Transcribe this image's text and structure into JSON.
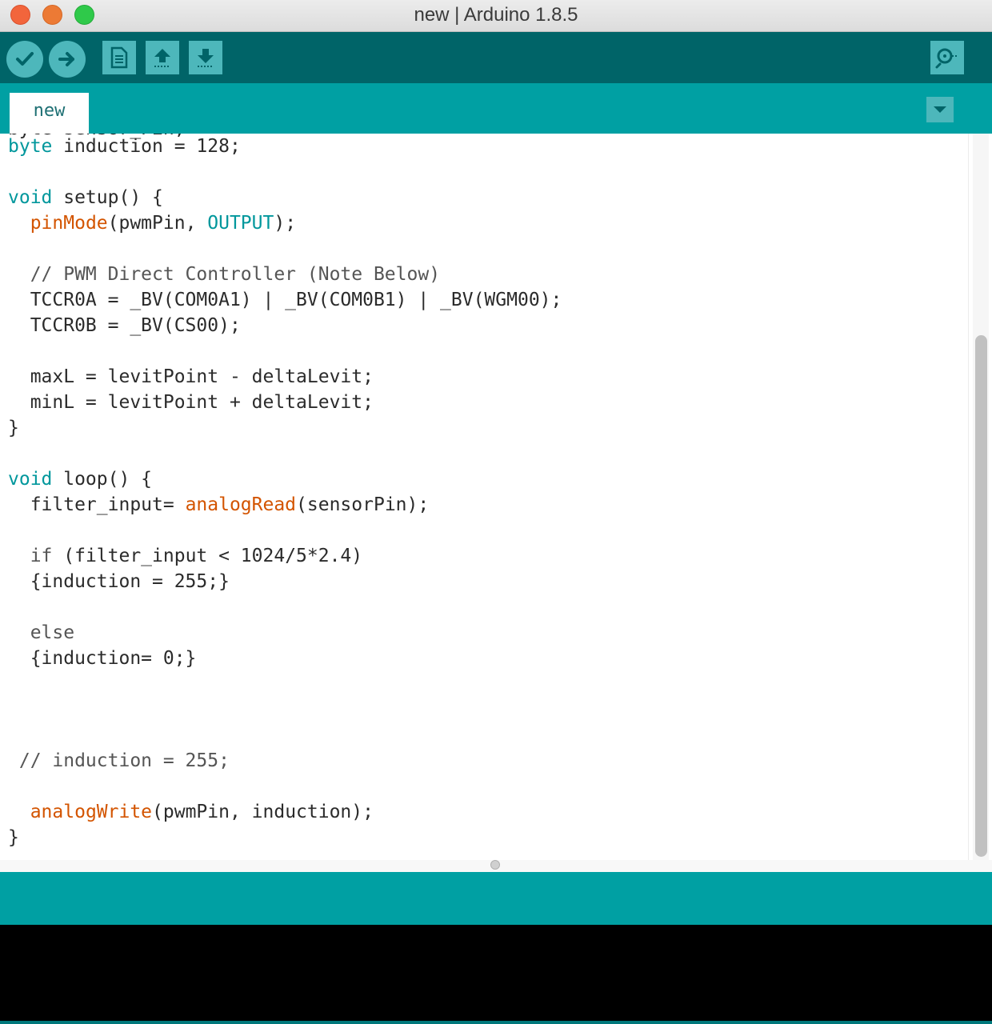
{
  "window": {
    "title": "new | Arduino 1.8.5"
  },
  "toolbar": {
    "buttons": [
      {
        "id": "verify",
        "icon": "check-icon"
      },
      {
        "id": "upload",
        "icon": "arrow-right-icon"
      },
      {
        "id": "new",
        "icon": "document-icon"
      },
      {
        "id": "open",
        "icon": "arrow-up-icon"
      },
      {
        "id": "save",
        "icon": "arrow-down-icon"
      },
      {
        "id": "serial-monitor",
        "icon": "magnifier-icon"
      }
    ]
  },
  "tabs": [
    {
      "label": "new",
      "active": true
    }
  ],
  "editor": {
    "lines": [
      [
        {
          "t": "byte",
          "c": "kw"
        },
        {
          "t": " induction = 128;",
          "c": ""
        }
      ],
      [],
      [
        {
          "t": "void",
          "c": "kw"
        },
        {
          "t": " setup() {",
          "c": ""
        }
      ],
      [
        {
          "t": "  ",
          "c": ""
        },
        {
          "t": "pinMode",
          "c": "fn"
        },
        {
          "t": "(pwmPin, ",
          "c": ""
        },
        {
          "t": "OUTPUT",
          "c": "kw"
        },
        {
          "t": ");",
          "c": ""
        }
      ],
      [],
      [
        {
          "t": "  // PWM Direct Controller (Note Below)",
          "c": "cmt"
        }
      ],
      [
        {
          "t": "  TCCR0A = _BV(COM0A1) | _BV(COM0B1) | _BV(WGM00);",
          "c": ""
        }
      ],
      [
        {
          "t": "  TCCR0B = _BV(CS00);",
          "c": ""
        }
      ],
      [],
      [
        {
          "t": "  maxL = levitPoint - deltaLevit;",
          "c": ""
        }
      ],
      [
        {
          "t": "  minL = levitPoint + deltaLevit;",
          "c": ""
        }
      ],
      [
        {
          "t": "}",
          "c": ""
        }
      ],
      [],
      [
        {
          "t": "void",
          "c": "kw"
        },
        {
          "t": " loop() {",
          "c": ""
        }
      ],
      [
        {
          "t": "  filter_input= ",
          "c": ""
        },
        {
          "t": "analogRead",
          "c": "fn"
        },
        {
          "t": "(sensorPin);",
          "c": ""
        }
      ],
      [],
      [
        {
          "t": "  ",
          "c": ""
        },
        {
          "t": "if",
          "c": "cmt"
        },
        {
          "t": " (filter_input < 1024/5*2.4)",
          "c": ""
        }
      ],
      [
        {
          "t": "  {induction = 255;}",
          "c": ""
        }
      ],
      [],
      [
        {
          "t": "  ",
          "c": ""
        },
        {
          "t": "else",
          "c": "cmt"
        }
      ],
      [
        {
          "t": "  {induction= 0;}",
          "c": ""
        }
      ],
      [],
      [],
      [],
      [
        {
          "t": " // induction = 255;",
          "c": "cmt"
        }
      ],
      [],
      [
        {
          "t": "  ",
          "c": ""
        },
        {
          "t": "analogWrite",
          "c": "fn"
        },
        {
          "t": "(pwmPin, induction);",
          "c": ""
        }
      ],
      [
        {
          "t": "}",
          "c": ""
        }
      ]
    ]
  },
  "status": {
    "message": ""
  },
  "colors": {
    "toolbar": "#006468",
    "tabbar": "#00a0a3",
    "button": "#4db7bb",
    "keyword": "#00979c",
    "function": "#d35400"
  }
}
